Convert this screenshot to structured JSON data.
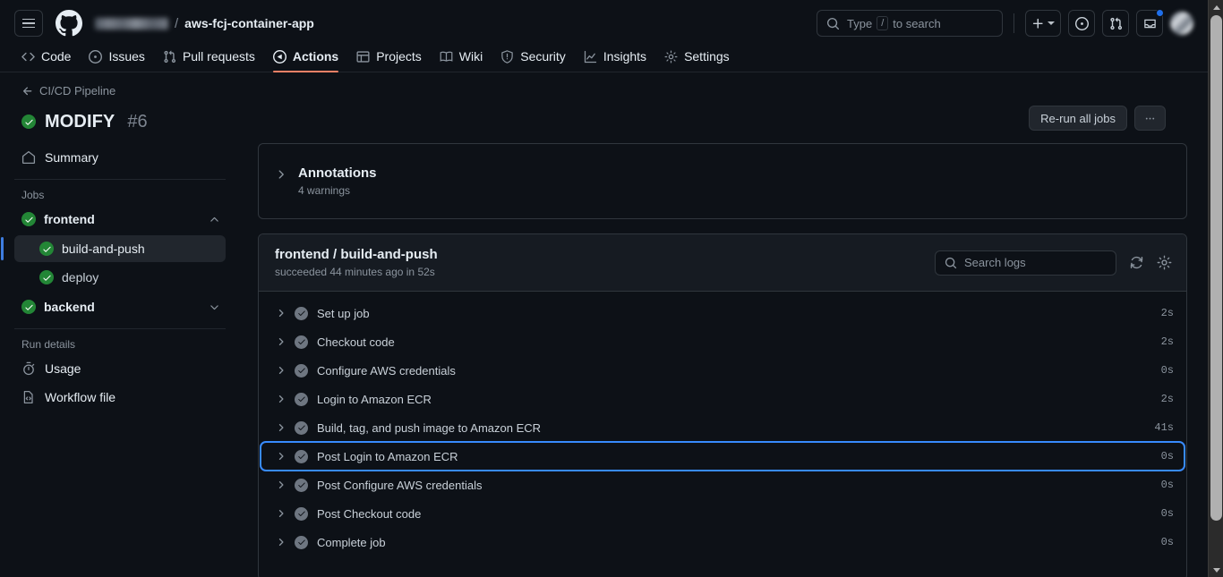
{
  "header": {
    "menu_label": "Open menu",
    "logo_name": "github-logo",
    "owner_redacted": "",
    "separator": "/",
    "repo": "aws-fcj-container-app",
    "search_placeholder_prefix": "Type",
    "search_key": "/",
    "search_placeholder_suffix": "to search",
    "create_new_label": "+",
    "issues_icon": "issues-icon",
    "pull_requests_icon": "pull-requests-icon",
    "notifications_icon": "inbox-icon"
  },
  "repo_nav": [
    {
      "label": "Code",
      "icon": "code-icon",
      "active": false
    },
    {
      "label": "Issues",
      "icon": "issue-opened-icon",
      "active": false
    },
    {
      "label": "Pull requests",
      "icon": "git-pull-request-icon",
      "active": false
    },
    {
      "label": "Actions",
      "icon": "play-icon",
      "active": true
    },
    {
      "label": "Projects",
      "icon": "table-icon",
      "active": false
    },
    {
      "label": "Wiki",
      "icon": "book-icon",
      "active": false
    },
    {
      "label": "Security",
      "icon": "shield-icon",
      "active": false
    },
    {
      "label": "Insights",
      "icon": "graph-icon",
      "active": false
    },
    {
      "label": "Settings",
      "icon": "gear-icon",
      "active": false
    }
  ],
  "run": {
    "back_label": "CI/CD Pipeline",
    "status": "success",
    "title": "MODIFY",
    "number": "#6",
    "rerun_label": "Re-run all jobs",
    "more_label": "…"
  },
  "sidebar": {
    "summary_label": "Summary",
    "jobs_heading": "Jobs",
    "jobs": [
      {
        "label": "frontend",
        "status": "success",
        "expanded": true,
        "children": [
          {
            "label": "build-and-push",
            "status": "success",
            "selected": true
          },
          {
            "label": "deploy",
            "status": "success",
            "selected": false
          }
        ]
      },
      {
        "label": "backend",
        "status": "success",
        "expanded": false,
        "children": []
      }
    ],
    "run_details_heading": "Run details",
    "run_details": [
      {
        "label": "Usage",
        "icon": "stopwatch-icon"
      },
      {
        "label": "Workflow file",
        "icon": "workflow-file-icon"
      }
    ]
  },
  "annotations": {
    "title": "Annotations",
    "subtitle": "4 warnings",
    "expanded": false
  },
  "job": {
    "title": "frontend / build-and-push",
    "subtitle": "succeeded 44 minutes ago in 52s",
    "search_placeholder": "Search logs",
    "refresh_icon": "sync-icon",
    "settings_icon": "gear-icon",
    "steps": [
      {
        "label": "Set up job",
        "status": "success",
        "duration": "2s",
        "focused": false
      },
      {
        "label": "Checkout code",
        "status": "success",
        "duration": "2s",
        "focused": false
      },
      {
        "label": "Configure AWS credentials",
        "status": "success",
        "duration": "0s",
        "focused": false
      },
      {
        "label": "Login to Amazon ECR",
        "status": "success",
        "duration": "2s",
        "focused": false
      },
      {
        "label": "Build, tag, and push image to Amazon ECR",
        "status": "success",
        "duration": "41s",
        "focused": false
      },
      {
        "label": "Post Login to Amazon ECR",
        "status": "success",
        "duration": "0s",
        "focused": true
      },
      {
        "label": "Post Configure AWS credentials",
        "status": "success",
        "duration": "0s",
        "focused": false
      },
      {
        "label": "Post Checkout code",
        "status": "success",
        "duration": "0s",
        "focused": false
      },
      {
        "label": "Complete job",
        "status": "success",
        "duration": "0s",
        "focused": false
      }
    ]
  },
  "colors": {
    "background": "#0d1117",
    "panel_border": "#30363d",
    "success_green": "#238636",
    "accent_blue": "#388bfd",
    "active_tab_underline": "#f78166",
    "muted_text": "#8b949e"
  }
}
